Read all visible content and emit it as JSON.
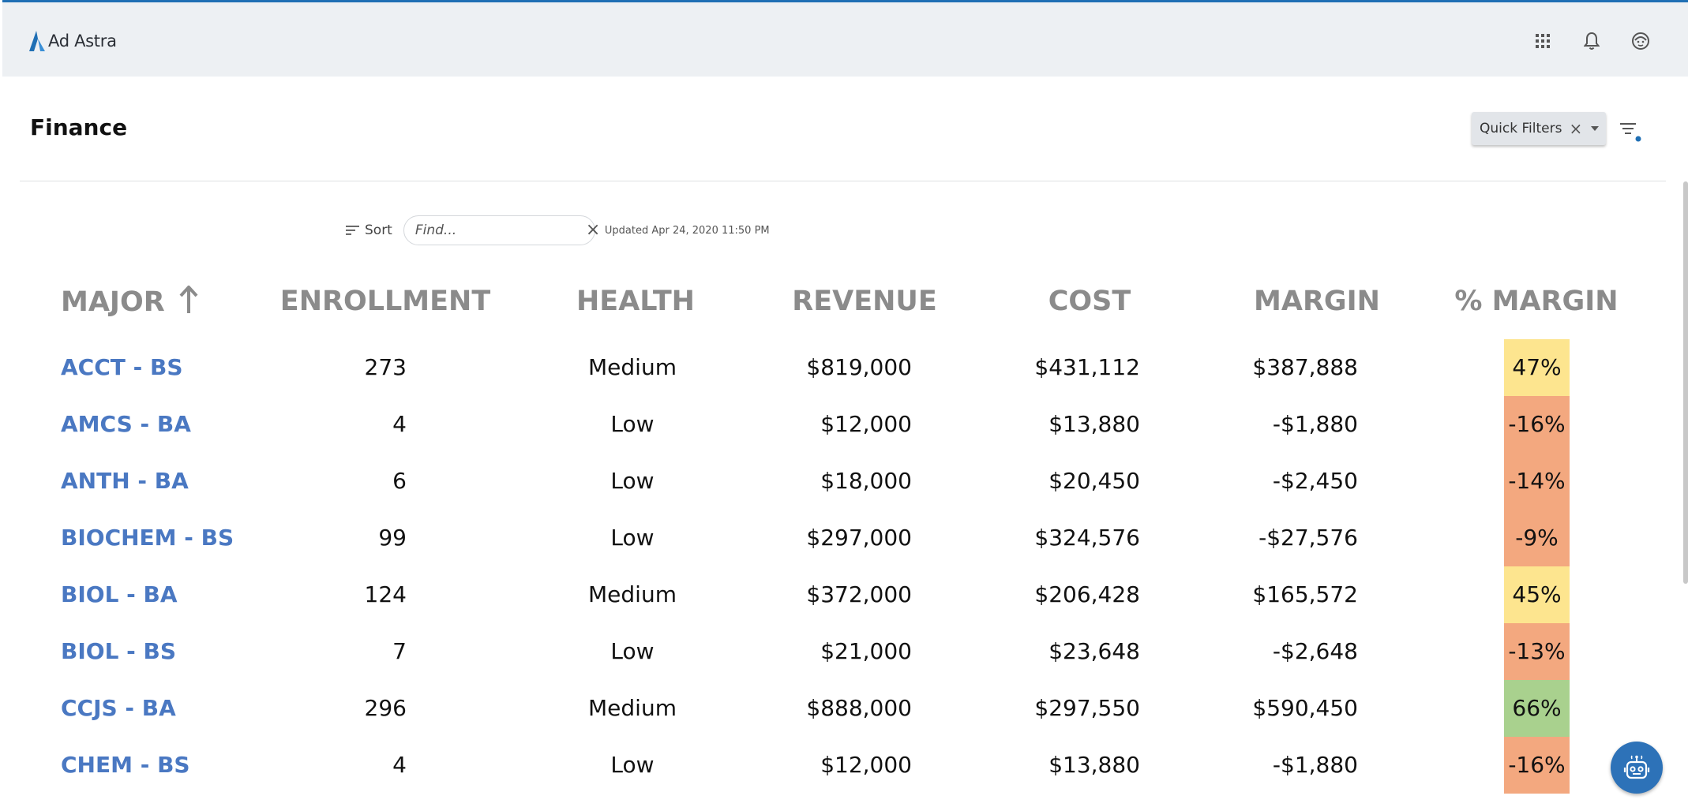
{
  "app": {
    "logo_text": "Ad Astra",
    "brand_color": "#1f6fb4",
    "header_icons": [
      "apps-grid-icon",
      "notification-bell-icon",
      "user-avatar-icon"
    ]
  },
  "page": {
    "title": "Finance"
  },
  "filters": {
    "quick_filters_label": "Quick Filters"
  },
  "toolbar": {
    "sort_label": "Sort",
    "find_placeholder": "Find...",
    "updated_text": "Updated Apr 24, 2020 11:50 PM"
  },
  "table": {
    "columns": {
      "major": "MAJOR",
      "enrollment": "ENROLLMENT",
      "health": "HEALTH",
      "revenue": "REVENUE",
      "cost": "COST",
      "margin": "MARGIN",
      "pct_margin": "% MARGIN"
    },
    "sorted_by": "major",
    "sort_direction": "ascending",
    "colors": {
      "medium": "#fde58f",
      "low": "#f3a87f",
      "high": "#a9d18e"
    },
    "rows": [
      {
        "major": "ACCT - BS",
        "enrollment": "273",
        "health": "Medium",
        "revenue": "$819,000",
        "cost": "$431,112",
        "margin": "$387,888",
        "pct_margin": "47%",
        "pct_color": "#fde58f"
      },
      {
        "major": "AMCS - BA",
        "enrollment": "4",
        "health": "Low",
        "revenue": "$12,000",
        "cost": "$13,880",
        "margin": "-$1,880",
        "pct_margin": "-16%",
        "pct_color": "#f3a87f"
      },
      {
        "major": "ANTH - BA",
        "enrollment": "6",
        "health": "Low",
        "revenue": "$18,000",
        "cost": "$20,450",
        "margin": "-$2,450",
        "pct_margin": "-14%",
        "pct_color": "#f3a87f"
      },
      {
        "major": "BIOCHEM - BS",
        "enrollment": "99",
        "health": "Low",
        "revenue": "$297,000",
        "cost": "$324,576",
        "margin": "-$27,576",
        "pct_margin": "-9%",
        "pct_color": "#f3a87f"
      },
      {
        "major": "BIOL - BA",
        "enrollment": "124",
        "health": "Medium",
        "revenue": "$372,000",
        "cost": "$206,428",
        "margin": "$165,572",
        "pct_margin": "45%",
        "pct_color": "#fde58f"
      },
      {
        "major": "BIOL - BS",
        "enrollment": "7",
        "health": "Low",
        "revenue": "$21,000",
        "cost": "$23,648",
        "margin": "-$2,648",
        "pct_margin": "-13%",
        "pct_color": "#f3a87f"
      },
      {
        "major": "CCJS - BA",
        "enrollment": "296",
        "health": "Medium",
        "revenue": "$888,000",
        "cost": "$297,550",
        "margin": "$590,450",
        "pct_margin": "66%",
        "pct_color": "#a9d18e"
      },
      {
        "major": "CHEM - BS",
        "enrollment": "4",
        "health": "Low",
        "revenue": "$12,000",
        "cost": "$13,880",
        "margin": "-$1,880",
        "pct_margin": "-16%",
        "pct_color": "#f3a87f"
      }
    ]
  }
}
